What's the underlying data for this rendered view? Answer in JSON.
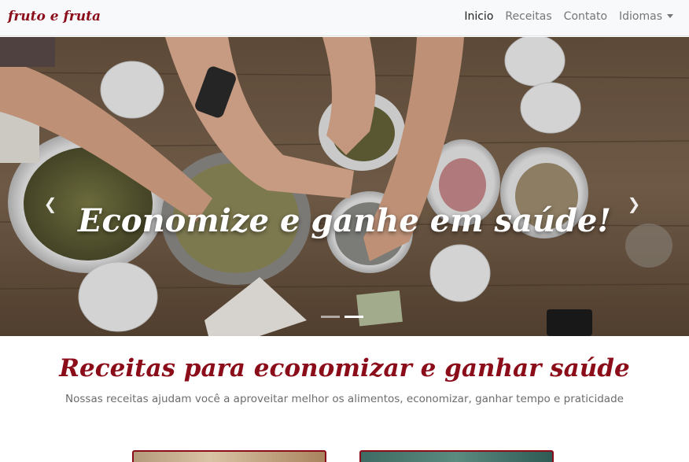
{
  "brand": {
    "name": "fruto e fruta"
  },
  "nav": {
    "items": [
      "Inicio",
      "Receitas",
      "Contato",
      "Idiomas"
    ]
  },
  "hero": {
    "caption": "Economize e ganhe em saúde!",
    "prev_icon": "chevron-left-icon",
    "next_icon": "chevron-right-icon",
    "slides": 2,
    "active_slide": 2
  },
  "section": {
    "title": "Receitas para economizar e ganhar saúde",
    "subtitle": "Nossas receitas ajudam você a aproveitar melhor os alimentos, economizar, ganhar tempo e praticidade"
  },
  "colors": {
    "brand": "#8b0d1a",
    "navbar_bg": "#f8f9fa"
  }
}
